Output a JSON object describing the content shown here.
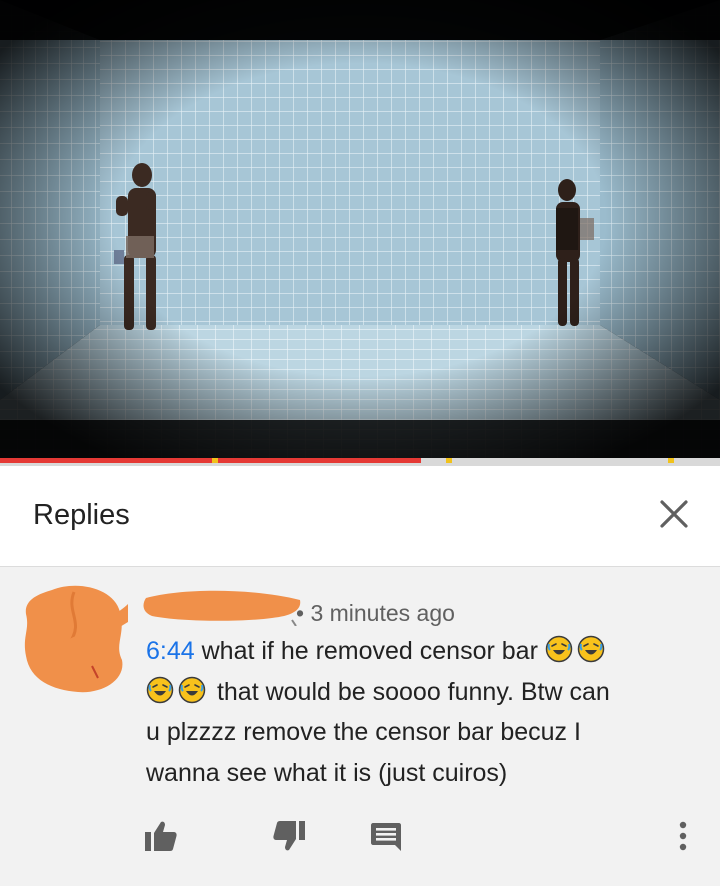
{
  "video": {
    "progress_percent": 58.5
  },
  "replies_panel": {
    "title": "Replies",
    "close_icon": "close-icon"
  },
  "comment": {
    "meta": "• 3 minutes ago",
    "timestamp": "6:44",
    "line1": " what if he removed censor bar ",
    "line2": " that would be soooo funny. Btw can",
    "line3": "u plzzzz remove the censor bar becuz I",
    "line4": "wanna see what it is (just cuiros)",
    "emoji_name": "rolling-on-floor-laughing-emoji"
  },
  "actions": {
    "like_icon": "thumbs-up-icon",
    "dislike_icon": "thumbs-down-icon",
    "reply_icon": "comment-reply-icon",
    "more_icon": "more-vertical-icon"
  },
  "colors": {
    "progress_red": "#e53935",
    "link_blue": "#1a73e8",
    "redaction_orange": "#f0904a"
  }
}
